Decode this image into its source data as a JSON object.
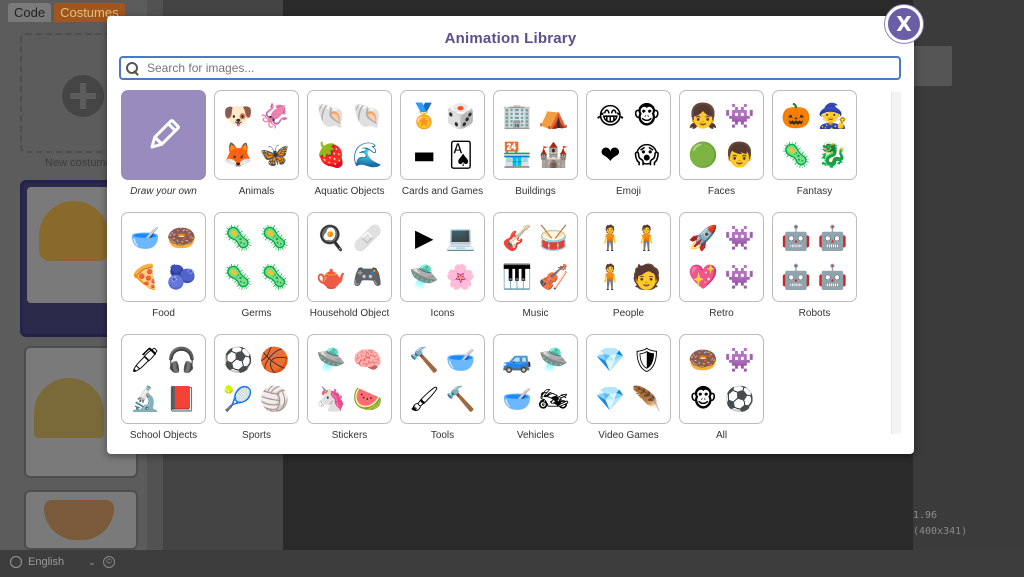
{
  "background": {
    "tabs": [
      "Code",
      "Costumes"
    ],
    "new_costume_label": "New costume",
    "coord_1": "1.96",
    "coord_2": "(400x341)",
    "language": "English"
  },
  "modal": {
    "title": "Animation Library",
    "close_label": "X",
    "search_placeholder": "Search for images...",
    "categories": [
      {
        "label": "Draw your own",
        "icons": []
      },
      {
        "label": "Animals",
        "icons": [
          "🐶",
          "🦑",
          "🦊",
          "🦋"
        ]
      },
      {
        "label": "Aquatic Objects",
        "icons": [
          "🐚",
          "🐚",
          "🍓",
          "🌊"
        ]
      },
      {
        "label": "Cards and Games",
        "icons": [
          "🏅",
          "🎲",
          "▬",
          "🂡"
        ]
      },
      {
        "label": "Buildings",
        "icons": [
          "🏢",
          "⛺",
          "🏪",
          "🏰"
        ]
      },
      {
        "label": "Emoji",
        "icons": [
          "😂",
          "🐵",
          "❤",
          "😱"
        ]
      },
      {
        "label": "Faces",
        "icons": [
          "👧",
          "👾",
          "🟢",
          "👦"
        ]
      },
      {
        "label": "Fantasy",
        "icons": [
          "🎃",
          "🧙",
          "🦠",
          "🐉"
        ]
      },
      {
        "label": "Food",
        "icons": [
          "🥣",
          "🍩",
          "🍕",
          "🫐"
        ]
      },
      {
        "label": "Germs",
        "icons": [
          "🦠",
          "🦠",
          "🦠",
          "🦠"
        ]
      },
      {
        "label": "Household Object",
        "icons": [
          "🍳",
          "🩹",
          "🫖",
          "🎮"
        ]
      },
      {
        "label": "Icons",
        "icons": [
          "▶",
          "💻",
          "🛸",
          "🌸"
        ]
      },
      {
        "label": "Music",
        "icons": [
          "🎸",
          "🥁",
          "🎹",
          "🎻"
        ]
      },
      {
        "label": "People",
        "icons": [
          "🧍",
          "🧍",
          "🧍",
          "🧑"
        ]
      },
      {
        "label": "Retro",
        "icons": [
          "🚀",
          "👾",
          "💖",
          "👾"
        ]
      },
      {
        "label": "Robots",
        "icons": [
          "🤖",
          "🤖",
          "🤖",
          "🤖"
        ]
      },
      {
        "label": "School Objects",
        "icons": [
          "🖊",
          "🎧",
          "🔬",
          "📕"
        ]
      },
      {
        "label": "Sports",
        "icons": [
          "⚽",
          "🏀",
          "🎾",
          "🏐"
        ]
      },
      {
        "label": "Stickers",
        "icons": [
          "🛸",
          "🧠",
          "🦄",
          "🍉"
        ]
      },
      {
        "label": "Tools",
        "icons": [
          "🔨",
          "🥣",
          "🖌",
          "🔨"
        ]
      },
      {
        "label": "Vehicles",
        "icons": [
          "🚙",
          "🛸",
          "🥣",
          "🏍"
        ]
      },
      {
        "label": "Video Games",
        "icons": [
          "💎",
          "🛡",
          "💎",
          "🪶"
        ]
      },
      {
        "label": "All",
        "icons": [
          "🍩",
          "👾",
          "🐵",
          "⚽"
        ]
      }
    ]
  },
  "colors": {
    "accent": "#6c5ea6",
    "title": "#5b4f8c",
    "draw_tile": "#9a8bbf",
    "search_border": "#4a79c6"
  }
}
